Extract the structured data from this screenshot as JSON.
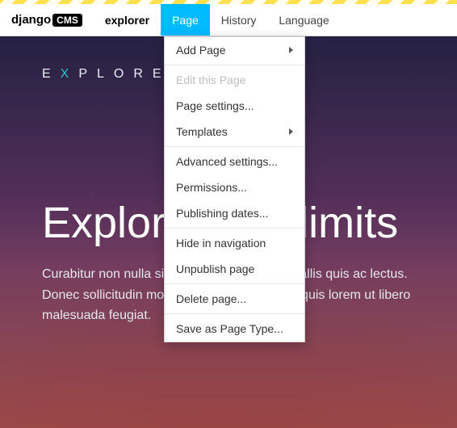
{
  "brand": {
    "base": "django",
    "tag": "CMS"
  },
  "toolbar": {
    "site": "explorer",
    "page": "Page",
    "history": "History",
    "language": "Language"
  },
  "dropdown": {
    "add_page": "Add Page",
    "edit_this_page": "Edit this Page",
    "page_settings": "Page settings...",
    "templates": "Templates",
    "advanced_settings": "Advanced settings...",
    "permissions": "Permissions...",
    "publishing_dates": "Publishing dates...",
    "hide_in_navigation": "Hide in navigation",
    "unpublish_page": "Unpublish page",
    "delete_page": "Delete page...",
    "save_as_page_type": "Save as Page Type..."
  },
  "hero": {
    "logo_pre": "E",
    "logo_x": "X",
    "logo_post": "PLORER",
    "title": "Explore your limits",
    "body": "Curabitur non nulla sit amet nisl tempus convallis quis ac lectus. Donec sollicitudin molestie malesuada. Nulla quis lorem ut libero malesuada feugiat."
  }
}
